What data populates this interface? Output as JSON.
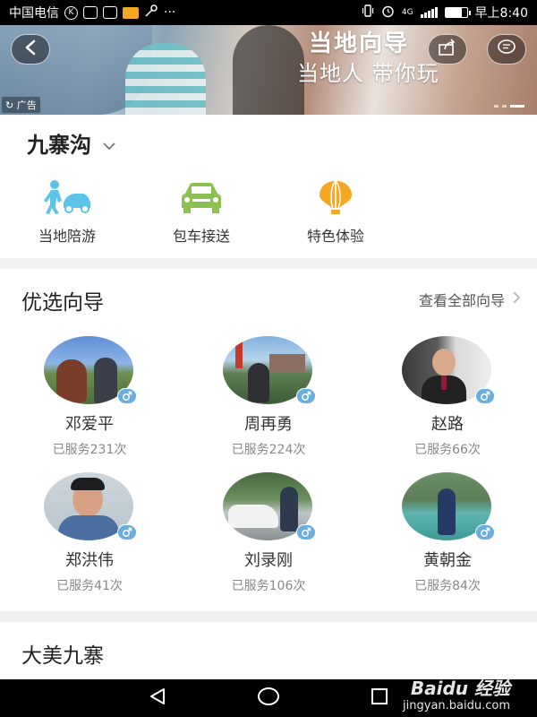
{
  "status_bar": {
    "carrier": "中国电信",
    "network": "4G",
    "battery_level": 0.75,
    "time": "早上8:40"
  },
  "banner": {
    "title": "当地向导",
    "subtitle": "当地人 带你玩",
    "ad_label": "广告",
    "back_icon": "back-arrow-icon",
    "share_icon": "share-icon",
    "message_icon": "chat-bubble-icon"
  },
  "location": {
    "name": "九寨沟",
    "icon": "chevron-down-icon"
  },
  "services": [
    {
      "label": "当地陪游",
      "icon": "person-car-icon",
      "color": "#5bc4e8"
    },
    {
      "label": "包车接送",
      "icon": "car-icon",
      "color": "#8cc152"
    },
    {
      "label": "特色体验",
      "icon": "hot-air-balloon-icon",
      "color": "#f5a623"
    }
  ],
  "guides_section": {
    "title": "优选向导",
    "view_all_label": "查看全部向导",
    "guides": [
      {
        "name": "邓爱平",
        "served": "已服务231次",
        "gender": "male"
      },
      {
        "name": "周再勇",
        "served": "已服务224次",
        "gender": "male"
      },
      {
        "name": "赵路",
        "served": "已服务66次",
        "gender": "male"
      },
      {
        "name": "郑洪伟",
        "served": "已服务41次",
        "gender": "male"
      },
      {
        "name": "刘录刚",
        "served": "已服务106次",
        "gender": "male"
      },
      {
        "name": "黄朝金",
        "served": "已服务84次",
        "gender": "male"
      }
    ]
  },
  "bottom_section": {
    "title": "大美九寨"
  },
  "watermark": {
    "text": "Baidu 经验",
    "url": "jingyan.baidu.com"
  },
  "colors": {
    "accent_blue": "#6aaee0",
    "text_dark": "#222222",
    "text_gray": "#888888"
  }
}
